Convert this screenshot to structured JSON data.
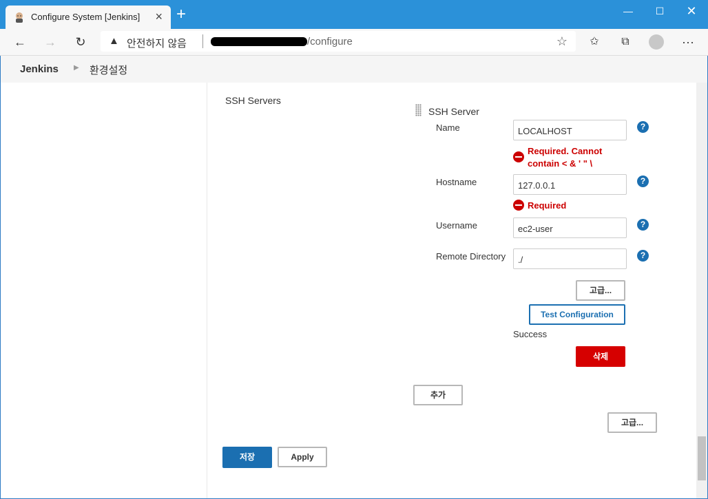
{
  "browser": {
    "tab_title": "Configure System [Jenkins]",
    "new_tab": "+",
    "security_warning": "안전하지 않음",
    "url_path": "/configure",
    "icons": [
      "jenkins-favicon-icon",
      "close-icon",
      "back-icon",
      "forward-icon",
      "refresh-icon",
      "warning-icon",
      "star-icon",
      "favorites-icon",
      "collections-icon",
      "profile-icon",
      "more-icon",
      "minimize-icon",
      "maximize-icon",
      "window-close-icon"
    ]
  },
  "breadcrumb": {
    "home": "Jenkins",
    "current": "환경설정"
  },
  "section": {
    "label": "SSH Servers"
  },
  "ssh_server": {
    "heading": "SSH Server",
    "name_label": "Name",
    "name_value": "LOCALHOST",
    "name_error_line1": "Required. Cannot",
    "name_error_line2": "contain < & ' \" \\",
    "hostname_label": "Hostname",
    "hostname_value": "127.0.0.1",
    "hostname_error": "Required",
    "username_label": "Username",
    "username_value": "ec2-user",
    "remote_dir_label": "Remote Directory",
    "remote_dir_value": "./",
    "advanced_label": "고급...",
    "test_label": "Test Configuration",
    "test_result": "Success",
    "delete_label": "삭제",
    "help_glyph": "?"
  },
  "add_label": "추가",
  "advanced2_label": "고급...",
  "save_label": "저장",
  "apply_label": "Apply",
  "colors": {
    "tabbar": "#2b91d9",
    "primary": "#1b6fb1",
    "danger": "#d60000",
    "error": "#cc0000"
  }
}
